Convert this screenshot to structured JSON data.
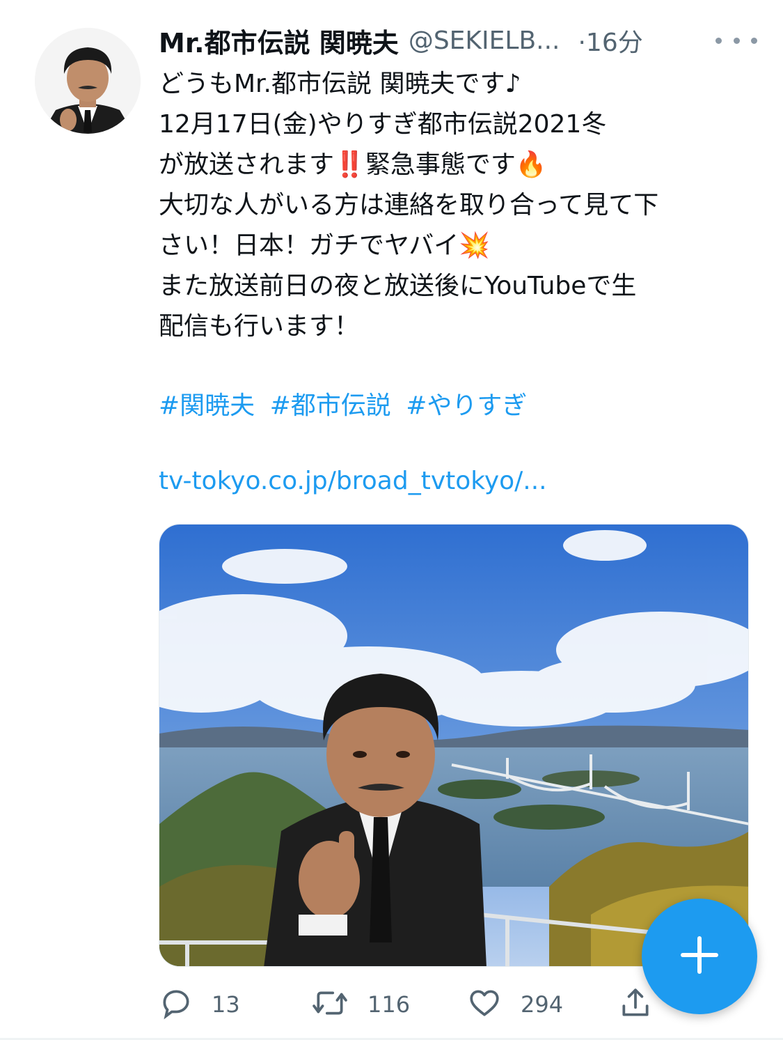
{
  "tweet": {
    "display_name": "Mr.都市伝説 関暁夫",
    "handle": "@SEKIELB...",
    "time": "·16分",
    "body": "どうもMr.都市伝説 関暁夫です♪\n12月17日(金)やりすぎ都市伝説2021冬\nが放送されます‼️緊急事態です🔥\n大切な人がいる方は連絡を取り合って見て下\nさい！日本！ガチでヤバイ💥\nまた放送前日の夜と放送後にYouTubeで生\n配信も行います！",
    "hashtags": [
      "#関暁夫",
      "#都市伝説",
      "#やりすぎ"
    ],
    "link": "tv-tokyo.co.jp/broad_tvtokyo/..."
  },
  "actions": {
    "reply_count": "13",
    "retweet_count": "116",
    "like_count": "294"
  },
  "icons": {
    "reply": "speech-bubble-icon",
    "retweet": "retweet-arrows-icon",
    "like": "heart-icon",
    "share": "share-upload-icon",
    "more": "ellipsis-icon",
    "compose": "plus-icon"
  },
  "colors": {
    "accent": "#1d9bf0",
    "text": "#0f1419",
    "secondary": "#536471"
  }
}
